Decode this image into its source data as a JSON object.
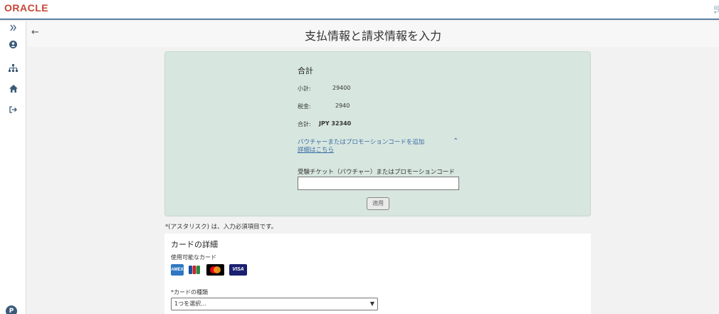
{
  "header": {
    "logo_text": "ORACLE",
    "page_title": "支払情報と請求情報を入力"
  },
  "sidebar": {
    "items": [
      {
        "icon": "expand-icon"
      },
      {
        "icon": "user-icon"
      },
      {
        "icon": "org-chart-icon"
      },
      {
        "icon": "home-icon"
      },
      {
        "icon": "sign-out-icon"
      }
    ]
  },
  "summary": {
    "title": "合計",
    "subtotal_label": "小計:",
    "subtotal_value": "29400",
    "tax_label": "税金:",
    "tax_value": "2940",
    "total_label": "合計:",
    "total_value": "JPY 32340",
    "promo_link_line1": "バウチャーまたはプロモーションコードを追加",
    "promo_link_line2": "詳細はこちら",
    "voucher_label": "受験チケット（バウチャー）またはプロモーションコード",
    "voucher_value": "",
    "apply_label": "適用"
  },
  "required_note": "*(アスタリスク) は、入力必須項目です。",
  "card": {
    "title": "カードの詳細",
    "available_label": "使用可能なカード",
    "brands": [
      "amex-icon",
      "jcb-icon",
      "mastercard-icon",
      "visa-icon"
    ],
    "type_label": "*カードの種類",
    "type_selected": "1つを選択..."
  },
  "colors": {
    "brand": "#c74634",
    "sidebar_icon": "#3b5a78",
    "summary_bg": "#d7e6df",
    "link": "#3b6ea5"
  }
}
